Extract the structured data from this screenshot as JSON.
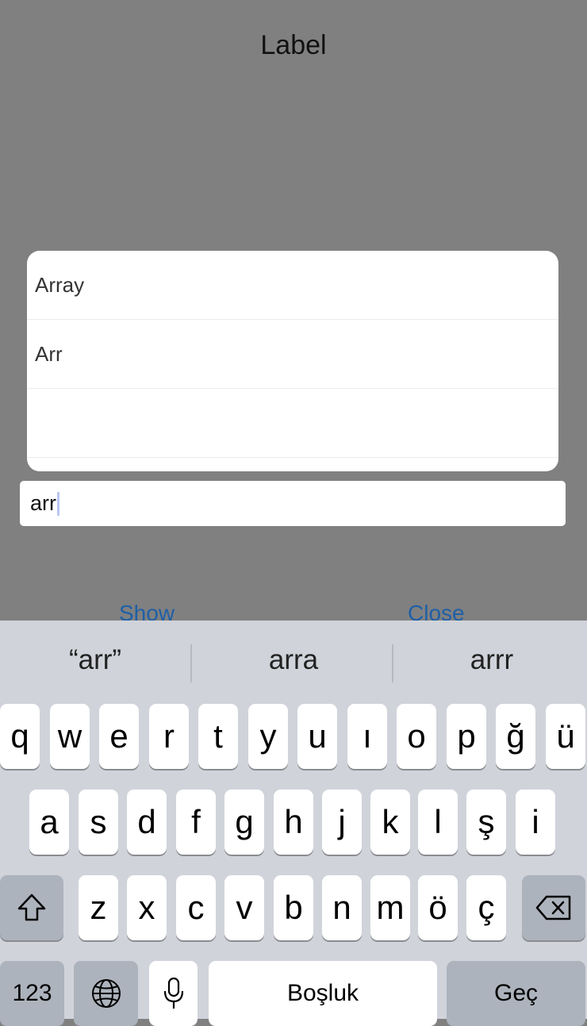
{
  "page": {
    "label": "Label"
  },
  "dropdown": {
    "items": [
      "Array",
      "Arr",
      ""
    ]
  },
  "input": {
    "value": "arr"
  },
  "buttons": {
    "show": "Show",
    "close": "Close"
  },
  "keyboard": {
    "suggestions": [
      "“arr”",
      "arra",
      "arrr"
    ],
    "row1": [
      "q",
      "w",
      "e",
      "r",
      "t",
      "y",
      "u",
      "ı",
      "o",
      "p",
      "ğ",
      "ü"
    ],
    "row2": [
      "a",
      "s",
      "d",
      "f",
      "g",
      "h",
      "j",
      "k",
      "l",
      "ş",
      "i"
    ],
    "row3": [
      "z",
      "x",
      "c",
      "v",
      "b",
      "n",
      "m",
      "ö",
      "ç"
    ],
    "numbers": "123",
    "space": "Boşluk",
    "return": "Geç",
    "icons": [
      "shift-icon",
      "backspace-icon",
      "globe-icon",
      "microphone-icon"
    ]
  }
}
